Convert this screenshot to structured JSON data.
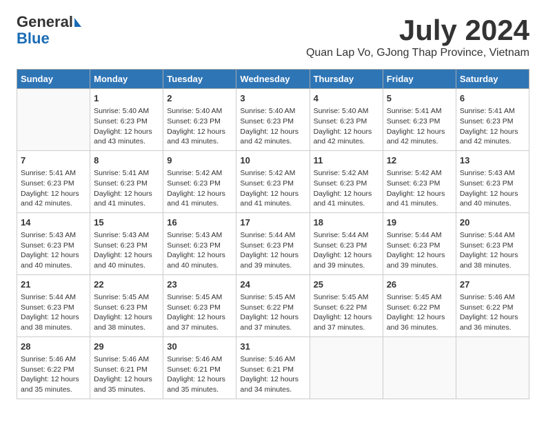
{
  "header": {
    "logo_general": "General",
    "logo_blue": "Blue",
    "month_title": "July 2024",
    "subtitle": "Quan Lap Vo, GJong Thap Province, Vietnam"
  },
  "calendar": {
    "days_of_week": [
      "Sunday",
      "Monday",
      "Tuesday",
      "Wednesday",
      "Thursday",
      "Friday",
      "Saturday"
    ],
    "weeks": [
      [
        {
          "day": "",
          "info": ""
        },
        {
          "day": "1",
          "info": "Sunrise: 5:40 AM\nSunset: 6:23 PM\nDaylight: 12 hours\nand 43 minutes."
        },
        {
          "day": "2",
          "info": "Sunrise: 5:40 AM\nSunset: 6:23 PM\nDaylight: 12 hours\nand 43 minutes."
        },
        {
          "day": "3",
          "info": "Sunrise: 5:40 AM\nSunset: 6:23 PM\nDaylight: 12 hours\nand 42 minutes."
        },
        {
          "day": "4",
          "info": "Sunrise: 5:40 AM\nSunset: 6:23 PM\nDaylight: 12 hours\nand 42 minutes."
        },
        {
          "day": "5",
          "info": "Sunrise: 5:41 AM\nSunset: 6:23 PM\nDaylight: 12 hours\nand 42 minutes."
        },
        {
          "day": "6",
          "info": "Sunrise: 5:41 AM\nSunset: 6:23 PM\nDaylight: 12 hours\nand 42 minutes."
        }
      ],
      [
        {
          "day": "7",
          "info": "Sunrise: 5:41 AM\nSunset: 6:23 PM\nDaylight: 12 hours\nand 42 minutes."
        },
        {
          "day": "8",
          "info": "Sunrise: 5:41 AM\nSunset: 6:23 PM\nDaylight: 12 hours\nand 41 minutes."
        },
        {
          "day": "9",
          "info": "Sunrise: 5:42 AM\nSunset: 6:23 PM\nDaylight: 12 hours\nand 41 minutes."
        },
        {
          "day": "10",
          "info": "Sunrise: 5:42 AM\nSunset: 6:23 PM\nDaylight: 12 hours\nand 41 minutes."
        },
        {
          "day": "11",
          "info": "Sunrise: 5:42 AM\nSunset: 6:23 PM\nDaylight: 12 hours\nand 41 minutes."
        },
        {
          "day": "12",
          "info": "Sunrise: 5:42 AM\nSunset: 6:23 PM\nDaylight: 12 hours\nand 41 minutes."
        },
        {
          "day": "13",
          "info": "Sunrise: 5:43 AM\nSunset: 6:23 PM\nDaylight: 12 hours\nand 40 minutes."
        }
      ],
      [
        {
          "day": "14",
          "info": "Sunrise: 5:43 AM\nSunset: 6:23 PM\nDaylight: 12 hours\nand 40 minutes."
        },
        {
          "day": "15",
          "info": "Sunrise: 5:43 AM\nSunset: 6:23 PM\nDaylight: 12 hours\nand 40 minutes."
        },
        {
          "day": "16",
          "info": "Sunrise: 5:43 AM\nSunset: 6:23 PM\nDaylight: 12 hours\nand 40 minutes."
        },
        {
          "day": "17",
          "info": "Sunrise: 5:44 AM\nSunset: 6:23 PM\nDaylight: 12 hours\nand 39 minutes."
        },
        {
          "day": "18",
          "info": "Sunrise: 5:44 AM\nSunset: 6:23 PM\nDaylight: 12 hours\nand 39 minutes."
        },
        {
          "day": "19",
          "info": "Sunrise: 5:44 AM\nSunset: 6:23 PM\nDaylight: 12 hours\nand 39 minutes."
        },
        {
          "day": "20",
          "info": "Sunrise: 5:44 AM\nSunset: 6:23 PM\nDaylight: 12 hours\nand 38 minutes."
        }
      ],
      [
        {
          "day": "21",
          "info": "Sunrise: 5:44 AM\nSunset: 6:23 PM\nDaylight: 12 hours\nand 38 minutes."
        },
        {
          "day": "22",
          "info": "Sunrise: 5:45 AM\nSunset: 6:23 PM\nDaylight: 12 hours\nand 38 minutes."
        },
        {
          "day": "23",
          "info": "Sunrise: 5:45 AM\nSunset: 6:23 PM\nDaylight: 12 hours\nand 37 minutes."
        },
        {
          "day": "24",
          "info": "Sunrise: 5:45 AM\nSunset: 6:22 PM\nDaylight: 12 hours\nand 37 minutes."
        },
        {
          "day": "25",
          "info": "Sunrise: 5:45 AM\nSunset: 6:22 PM\nDaylight: 12 hours\nand 37 minutes."
        },
        {
          "day": "26",
          "info": "Sunrise: 5:45 AM\nSunset: 6:22 PM\nDaylight: 12 hours\nand 36 minutes."
        },
        {
          "day": "27",
          "info": "Sunrise: 5:46 AM\nSunset: 6:22 PM\nDaylight: 12 hours\nand 36 minutes."
        }
      ],
      [
        {
          "day": "28",
          "info": "Sunrise: 5:46 AM\nSunset: 6:22 PM\nDaylight: 12 hours\nand 35 minutes."
        },
        {
          "day": "29",
          "info": "Sunrise: 5:46 AM\nSunset: 6:21 PM\nDaylight: 12 hours\nand 35 minutes."
        },
        {
          "day": "30",
          "info": "Sunrise: 5:46 AM\nSunset: 6:21 PM\nDaylight: 12 hours\nand 35 minutes."
        },
        {
          "day": "31",
          "info": "Sunrise: 5:46 AM\nSunset: 6:21 PM\nDaylight: 12 hours\nand 34 minutes."
        },
        {
          "day": "",
          "info": ""
        },
        {
          "day": "",
          "info": ""
        },
        {
          "day": "",
          "info": ""
        }
      ]
    ]
  }
}
